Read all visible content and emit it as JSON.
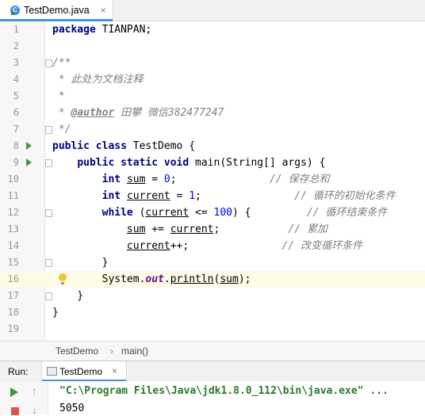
{
  "tab": {
    "icon": "java-class-icon",
    "title": "TestDemo.java",
    "close": "×"
  },
  "lines": [
    {
      "n": "1",
      "parts": [
        {
          "t": "package",
          "c": "kw"
        },
        {
          "t": " TIANPAN;",
          "c": ""
        }
      ]
    },
    {
      "n": "2",
      "parts": []
    },
    {
      "n": "3",
      "parts": [
        {
          "t": "/**",
          "c": "cm"
        }
      ]
    },
    {
      "n": "4",
      "parts": [
        {
          "t": " * 此处为文档注释",
          "c": "cm"
        }
      ]
    },
    {
      "n": "5",
      "parts": [
        {
          "t": " *",
          "c": "cm"
        }
      ]
    },
    {
      "n": "6",
      "parts": [
        {
          "t": " * ",
          "c": "cm"
        },
        {
          "t": "@author",
          "c": "tag"
        },
        {
          "t": " 田攀 微信382477247",
          "c": "cm"
        }
      ]
    },
    {
      "n": "7",
      "parts": [
        {
          "t": " */",
          "c": "cm"
        }
      ]
    },
    {
      "n": "8",
      "parts": [
        {
          "t": "public class",
          "c": "kw"
        },
        {
          "t": " TestDemo {",
          "c": ""
        }
      ]
    },
    {
      "n": "9",
      "parts": [
        {
          "t": "    ",
          "c": ""
        },
        {
          "t": "public static void",
          "c": "kw"
        },
        {
          "t": " main(String[] args) {",
          "c": ""
        }
      ]
    },
    {
      "n": "10",
      "parts": [
        {
          "t": "        ",
          "c": ""
        },
        {
          "t": "int",
          "c": "kw"
        },
        {
          "t": " ",
          "c": ""
        },
        {
          "t": "sum",
          "c": "ul"
        },
        {
          "t": " = ",
          "c": ""
        },
        {
          "t": "0",
          "c": "num"
        },
        {
          "t": ";               ",
          "c": ""
        },
        {
          "t": "// 保存总和",
          "c": "cm"
        }
      ]
    },
    {
      "n": "11",
      "parts": [
        {
          "t": "        ",
          "c": ""
        },
        {
          "t": "int",
          "c": "kw"
        },
        {
          "t": " ",
          "c": ""
        },
        {
          "t": "current",
          "c": "ul"
        },
        {
          "t": " = ",
          "c": ""
        },
        {
          "t": "1",
          "c": "num"
        },
        {
          "t": ";               ",
          "c": ""
        },
        {
          "t": "// 循环的初始化条件",
          "c": "cm"
        }
      ]
    },
    {
      "n": "12",
      "parts": [
        {
          "t": "        ",
          "c": ""
        },
        {
          "t": "while",
          "c": "kw"
        },
        {
          "t": " (",
          "c": ""
        },
        {
          "t": "current",
          "c": "ul"
        },
        {
          "t": " <= ",
          "c": ""
        },
        {
          "t": "100",
          "c": "num"
        },
        {
          "t": ") {         ",
          "c": ""
        },
        {
          "t": "// 循环结束条件",
          "c": "cm"
        }
      ]
    },
    {
      "n": "13",
      "parts": [
        {
          "t": "            ",
          "c": ""
        },
        {
          "t": "sum",
          "c": "ul"
        },
        {
          "t": " += ",
          "c": ""
        },
        {
          "t": "current",
          "c": "ul"
        },
        {
          "t": ";           ",
          "c": ""
        },
        {
          "t": "// 累加",
          "c": "cm"
        }
      ]
    },
    {
      "n": "14",
      "parts": [
        {
          "t": "            ",
          "c": ""
        },
        {
          "t": "current",
          "c": "ul"
        },
        {
          "t": "++;               ",
          "c": ""
        },
        {
          "t": "// 改变循环条件",
          "c": "cm"
        }
      ]
    },
    {
      "n": "15",
      "parts": [
        {
          "t": "        }",
          "c": ""
        }
      ]
    },
    {
      "n": "16",
      "parts": [
        {
          "t": "        System.",
          "c": ""
        },
        {
          "t": "out",
          "c": "field"
        },
        {
          "t": ".",
          "c": ""
        },
        {
          "t": "println",
          "c": "ul"
        },
        {
          "t": "(",
          "c": ""
        },
        {
          "t": "sum",
          "c": "ul"
        },
        {
          "t": ");",
          "c": ""
        }
      ]
    },
    {
      "n": "17",
      "parts": [
        {
          "t": "    }",
          "c": ""
        }
      ]
    },
    {
      "n": "18",
      "parts": [
        {
          "t": "}",
          "c": ""
        }
      ]
    },
    {
      "n": "19",
      "parts": []
    }
  ],
  "breadcrumb": {
    "items": [
      "TestDemo",
      "main()"
    ],
    "separator": "›"
  },
  "run": {
    "label": "Run:",
    "tab_title": "TestDemo",
    "close": "×"
  },
  "console": {
    "command": "\"C:\\Program Files\\Java\\jdk1.8.0_112\\bin\\java.exe\" ...",
    "output": "5050"
  }
}
